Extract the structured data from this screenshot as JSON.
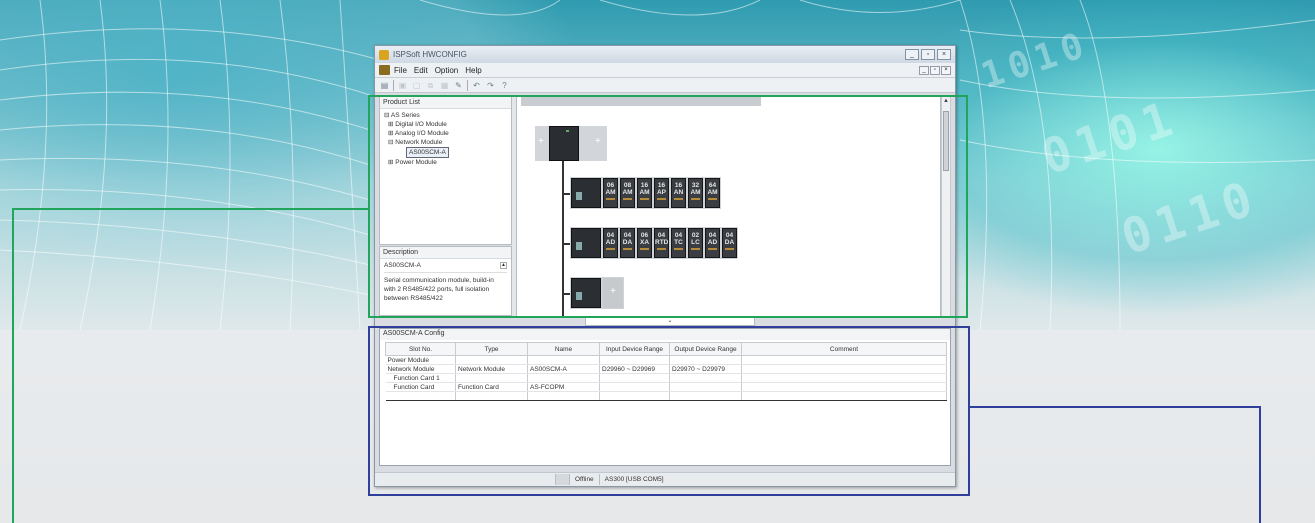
{
  "window": {
    "title": "ISPSoft HWCONFIG",
    "controls": [
      "_",
      "▫",
      "×"
    ],
    "mdi_controls": [
      "_",
      "▫",
      "×"
    ]
  },
  "menu": [
    "File",
    "Edit",
    "Option",
    "Help"
  ],
  "toolbar": [
    "new",
    "save",
    "open",
    "copy",
    "paste",
    "undo",
    "redo",
    "help"
  ],
  "product_list": {
    "header": "Product List",
    "root": "AS Series",
    "items": [
      "Digital I/O Module",
      "Analog I/O Module",
      "Network Module",
      "Power Module"
    ],
    "selected": "AS00SCM-A"
  },
  "description": {
    "header": "Description",
    "part_number": "AS00SCM-A",
    "text": "Serial communication module, build-in with 2 RS485/422 ports, full isolation between RS485/422"
  },
  "canvas": {
    "rack1_modules": [
      "06 AM",
      "08 AM",
      "16 AM",
      "16 AP",
      "16 AN",
      "32 AM",
      "64 AM"
    ],
    "rack2_modules": [
      "04 AD",
      "04 DA",
      "06 XA",
      "04 RTD",
      "04 TC",
      "02 LC",
      "04 AD",
      "04 DA"
    ],
    "add_glyph": "+"
  },
  "bottom_panel": {
    "header": "AS00SCM-A Config",
    "columns": [
      "Slot No.",
      "Type",
      "Name",
      "Input Device Range",
      "Output Device Range",
      "Comment"
    ],
    "rows": [
      [
        "Power Module",
        "",
        "",
        "",
        "",
        ""
      ],
      [
        "Network Module",
        "Network Module",
        "AS00SCM-A",
        "D29960 ~ D29969",
        "D29970 ~ D29979",
        ""
      ],
      [
        "Function Card 1",
        "",
        "",
        "",
        "",
        ""
      ],
      [
        "Function Card",
        "Function Card",
        "AS-FCOPM",
        "",
        "",
        ""
      ],
      [
        "",
        "",
        "",
        "",
        "",
        ""
      ]
    ]
  },
  "status": {
    "state": "Offline",
    "connection": "AS300 [USB COM5]"
  },
  "colors": {
    "highlight_top": "#20a55b",
    "highlight_bottom": "#2f3f9a"
  }
}
